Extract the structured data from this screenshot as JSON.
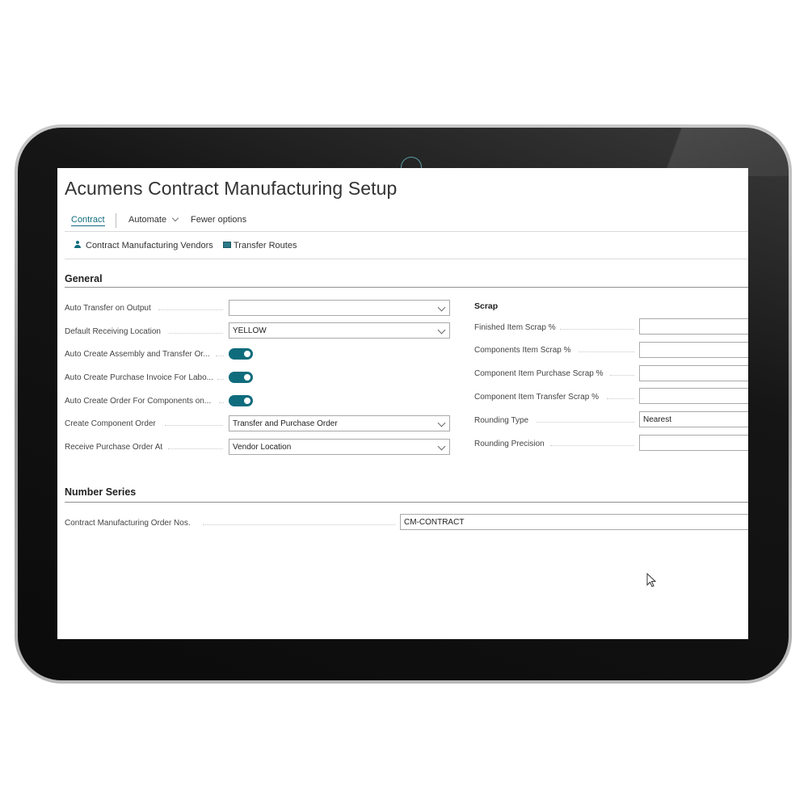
{
  "page": {
    "title": "Acumens Contract Manufacturing Setup"
  },
  "actionbar": {
    "contract": "Contract",
    "automate": "Automate",
    "fewer_options": "Fewer options"
  },
  "subbar": {
    "vendors": "Contract Manufacturing Vendors",
    "routes": "Transfer Routes"
  },
  "general": {
    "heading": "General",
    "auto_transfer_label": "Auto Transfer on Output",
    "auto_transfer_value": "",
    "default_location_label": "Default Receiving Location",
    "default_location_value": "YELLOW",
    "auto_assembly_label": "Auto Create Assembly and Transfer Or...",
    "auto_assembly_on": true,
    "auto_invoice_label": "Auto Create Purchase Invoice For Labo...",
    "auto_invoice_on": true,
    "auto_components_label": "Auto Create Order For Components on...",
    "auto_components_on": true,
    "component_order_label": "Create Component Order",
    "component_order_value": "Transfer and Purchase Order",
    "receive_po_label": "Receive Purchase Order At",
    "receive_po_value": "Vendor Location"
  },
  "scrap": {
    "heading": "Scrap",
    "finished_label": "Finished Item Scrap %",
    "finished_value": "",
    "components_label": "Components Item Scrap %",
    "components_value": "",
    "comp_purchase_label": "Component Item Purchase Scrap %",
    "comp_purchase_value": "",
    "comp_transfer_label": "Component Item Transfer Scrap %",
    "comp_transfer_value": "",
    "rounding_type_label": "Rounding Type",
    "rounding_type_value": "Nearest",
    "rounding_precision_label": "Rounding Precision",
    "rounding_precision_value": ""
  },
  "number_series": {
    "heading": "Number Series",
    "cm_order_nos_label": "Contract Manufacturing Order Nos.",
    "cm_order_nos_value": "CM-CONTRACT"
  },
  "colors": {
    "accent": "#0f6c7c",
    "text": "#333333",
    "border": "#a9a9a9"
  }
}
